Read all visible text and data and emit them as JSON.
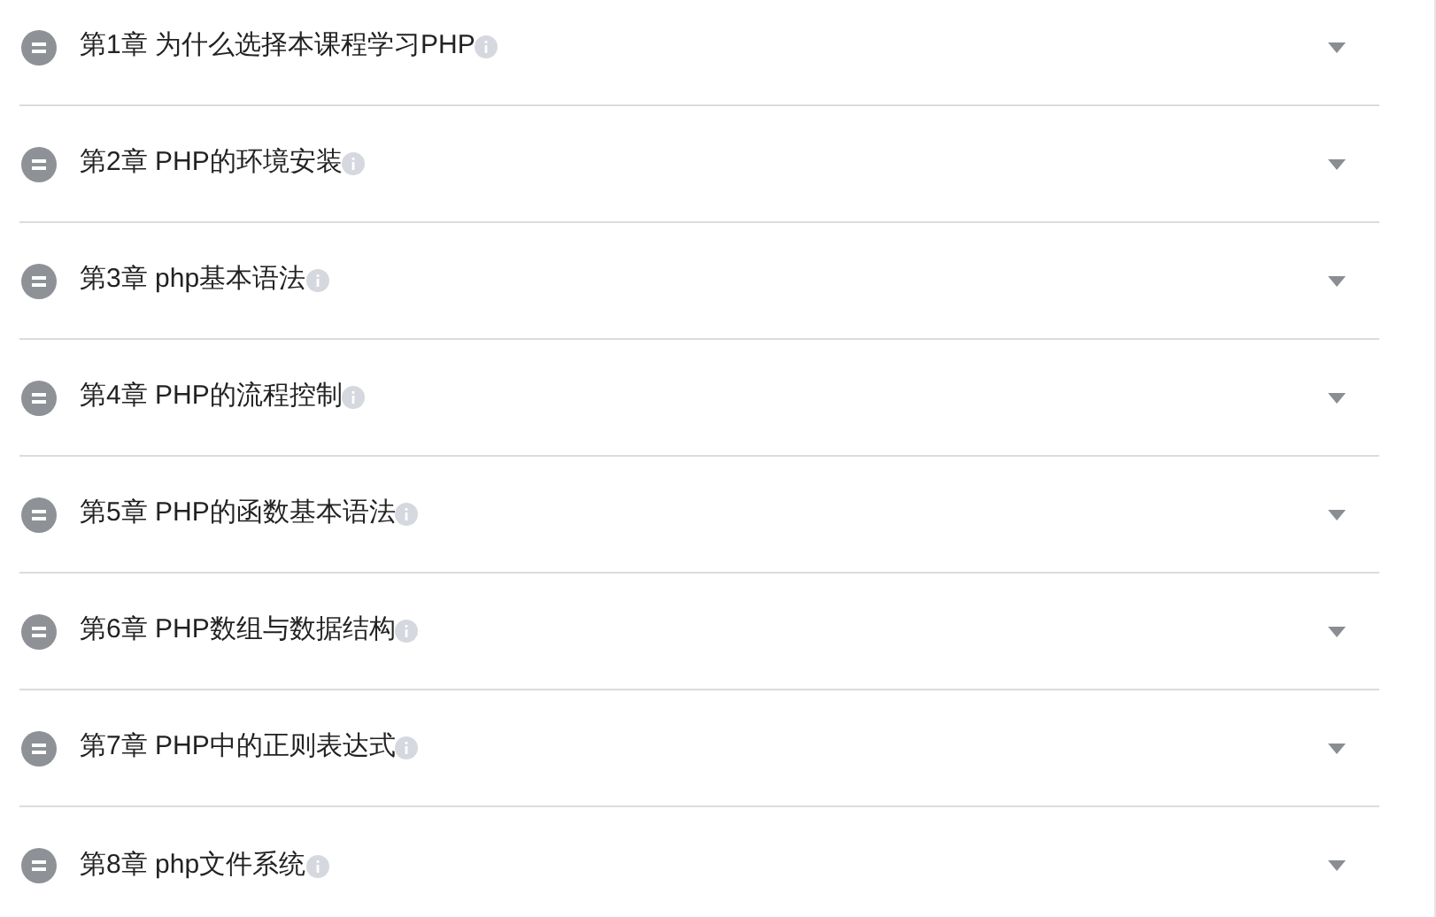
{
  "chapters": [
    {
      "title": "第1章 为什么选择本课程学习PHP",
      "expanded": false
    },
    {
      "title": "第2章 PHP的环境安装",
      "expanded": false
    },
    {
      "title": "第3章 php基本语法",
      "expanded": false
    },
    {
      "title": "第4章 PHP的流程控制",
      "expanded": false
    },
    {
      "title": "第5章 PHP的函数基本语法",
      "expanded": false
    },
    {
      "title": "第6章 PHP数组与数据结构",
      "expanded": false
    },
    {
      "title": "第7章 PHP中的正则表达式",
      "expanded": false
    },
    {
      "title": "第8章 php文件系统",
      "expanded": false
    }
  ]
}
